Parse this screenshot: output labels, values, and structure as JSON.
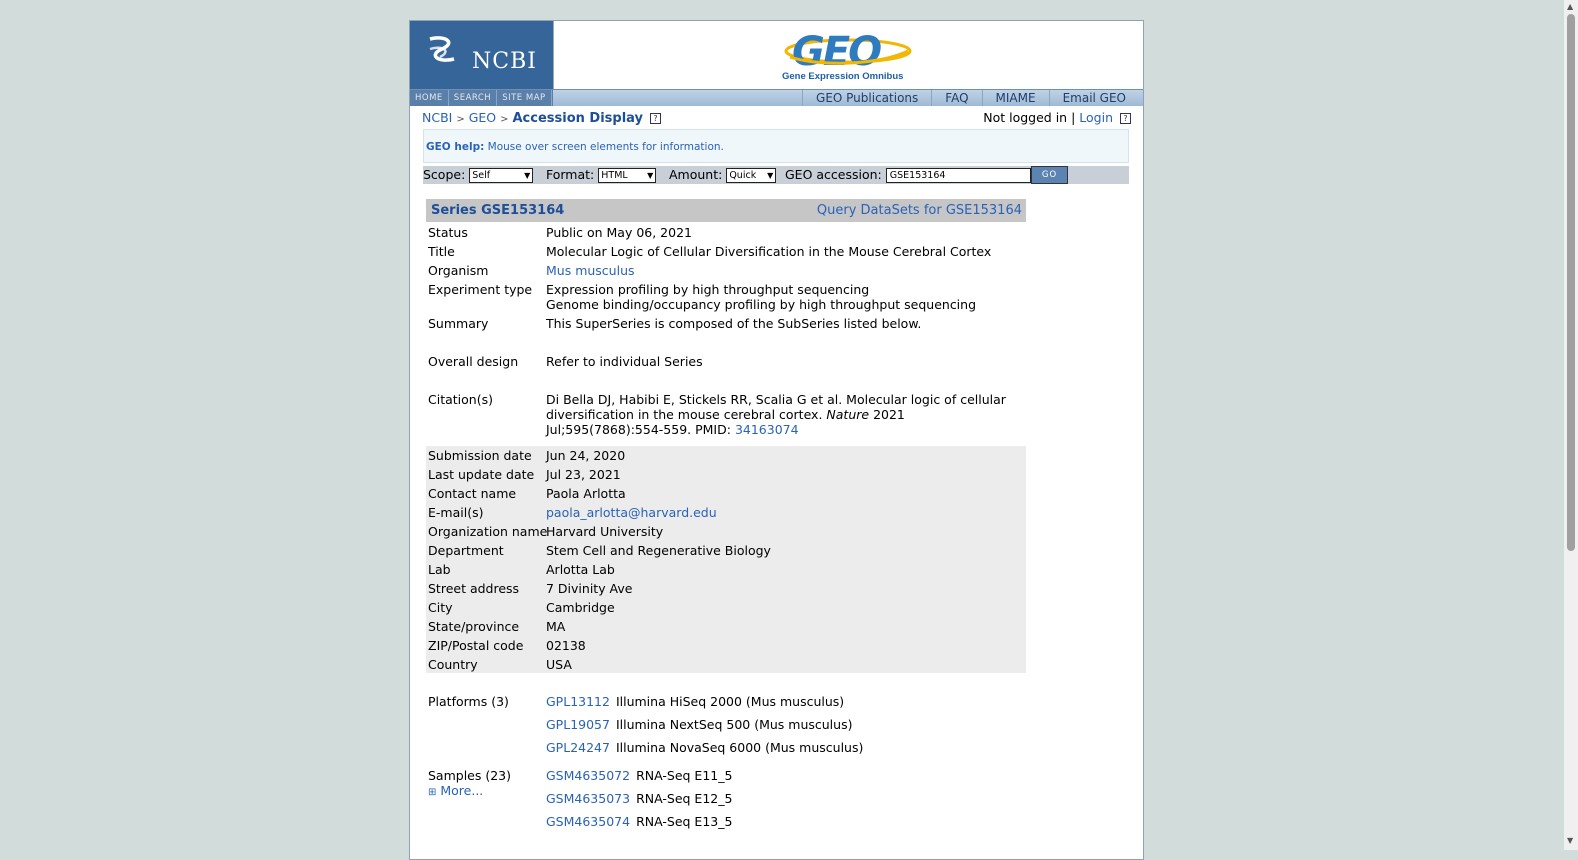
{
  "header": {
    "ncbi_logo_text": "NCBI",
    "geo_logo_text": "GEO",
    "geo_subtitle": "Gene Expression Omnibus",
    "left_nav": [
      "HOME",
      "SEARCH",
      "SITE MAP"
    ],
    "right_nav": [
      "GEO Publications",
      "FAQ",
      "MIAME",
      "Email GEO"
    ]
  },
  "breadcrumb": {
    "items": [
      "NCBI",
      "GEO"
    ],
    "current": "Accession Display",
    "sep": ">"
  },
  "login": {
    "status": "Not logged in",
    "sep": "|",
    "link": "Login"
  },
  "help": {
    "label": "GEO help:",
    "text": "Mouse over screen elements for information."
  },
  "query": {
    "scope_label": "Scope:",
    "scope_value": "Self",
    "format_label": "Format:",
    "format_value": "HTML",
    "amount_label": "Amount:",
    "amount_value": "Quick",
    "accession_label": "GEO accession:",
    "accession_value": "GSE153164",
    "go_label": "GO"
  },
  "series": {
    "title": "Series GSE153164",
    "query_link": "Query DataSets for GSE153164",
    "status_k": "Status",
    "status_v": "Public on May 06, 2021",
    "title_k": "Title",
    "title_v": "Molecular Logic of Cellular Diversification in the Mouse Cerebral Cortex",
    "organism_k": "Organism",
    "organism_v": "Mus musculus",
    "exp_k": "Experiment type",
    "exp_v1": "Expression profiling by high throughput sequencing",
    "exp_v2": "Genome binding/occupancy profiling by high throughput sequencing",
    "summary_k": "Summary",
    "summary_v": "This SuperSeries is composed of the SubSeries listed below.",
    "design_k": "Overall design",
    "design_v": "Refer to individual Series",
    "citation_k": "Citation(s)",
    "citation_a": "Di Bella DJ, Habibi E, Stickels RR, Scalia G et al. Molecular logic of cellular diversification in the mouse cerebral cortex.",
    "citation_journal": "Nature",
    "citation_b": "2021 Jul;595(7868):554-559. PMID:",
    "citation_pmid": "34163074"
  },
  "contact": [
    {
      "k": "Submission date",
      "v": "Jun 24, 2020"
    },
    {
      "k": "Last update date",
      "v": "Jul 23, 2021"
    },
    {
      "k": "Contact name",
      "v": "Paola Arlotta"
    },
    {
      "k": "E-mail(s)",
      "v": "paola_arlotta@harvard.edu"
    },
    {
      "k": "Organization name",
      "v": "Harvard University"
    },
    {
      "k": "Department",
      "v": "Stem Cell and Regenerative Biology"
    },
    {
      "k": "Lab",
      "v": "Arlotta Lab"
    },
    {
      "k": "Street address",
      "v": "7 Divinity Ave"
    },
    {
      "k": "City",
      "v": "Cambridge"
    },
    {
      "k": "State/province",
      "v": "MA"
    },
    {
      "k": "ZIP/Postal code",
      "v": "02138"
    },
    {
      "k": "Country",
      "v": "USA"
    }
  ],
  "platforms": {
    "label": "Platforms (3)",
    "items": [
      {
        "id": "GPL13112",
        "desc": "Illumina HiSeq 2000 (Mus musculus)"
      },
      {
        "id": "GPL19057",
        "desc": "Illumina NextSeq 500 (Mus musculus)"
      },
      {
        "id": "GPL24247",
        "desc": "Illumina NovaSeq 6000 (Mus musculus)"
      }
    ]
  },
  "samples": {
    "label": "Samples (23)",
    "more": "More...",
    "items": [
      {
        "id": "GSM4635072",
        "desc": "RNA-Seq E11_5"
      },
      {
        "id": "GSM4635073",
        "desc": "RNA-Seq E12_5"
      },
      {
        "id": "GSM4635074",
        "desc": "RNA-Seq E13_5"
      }
    ]
  }
}
